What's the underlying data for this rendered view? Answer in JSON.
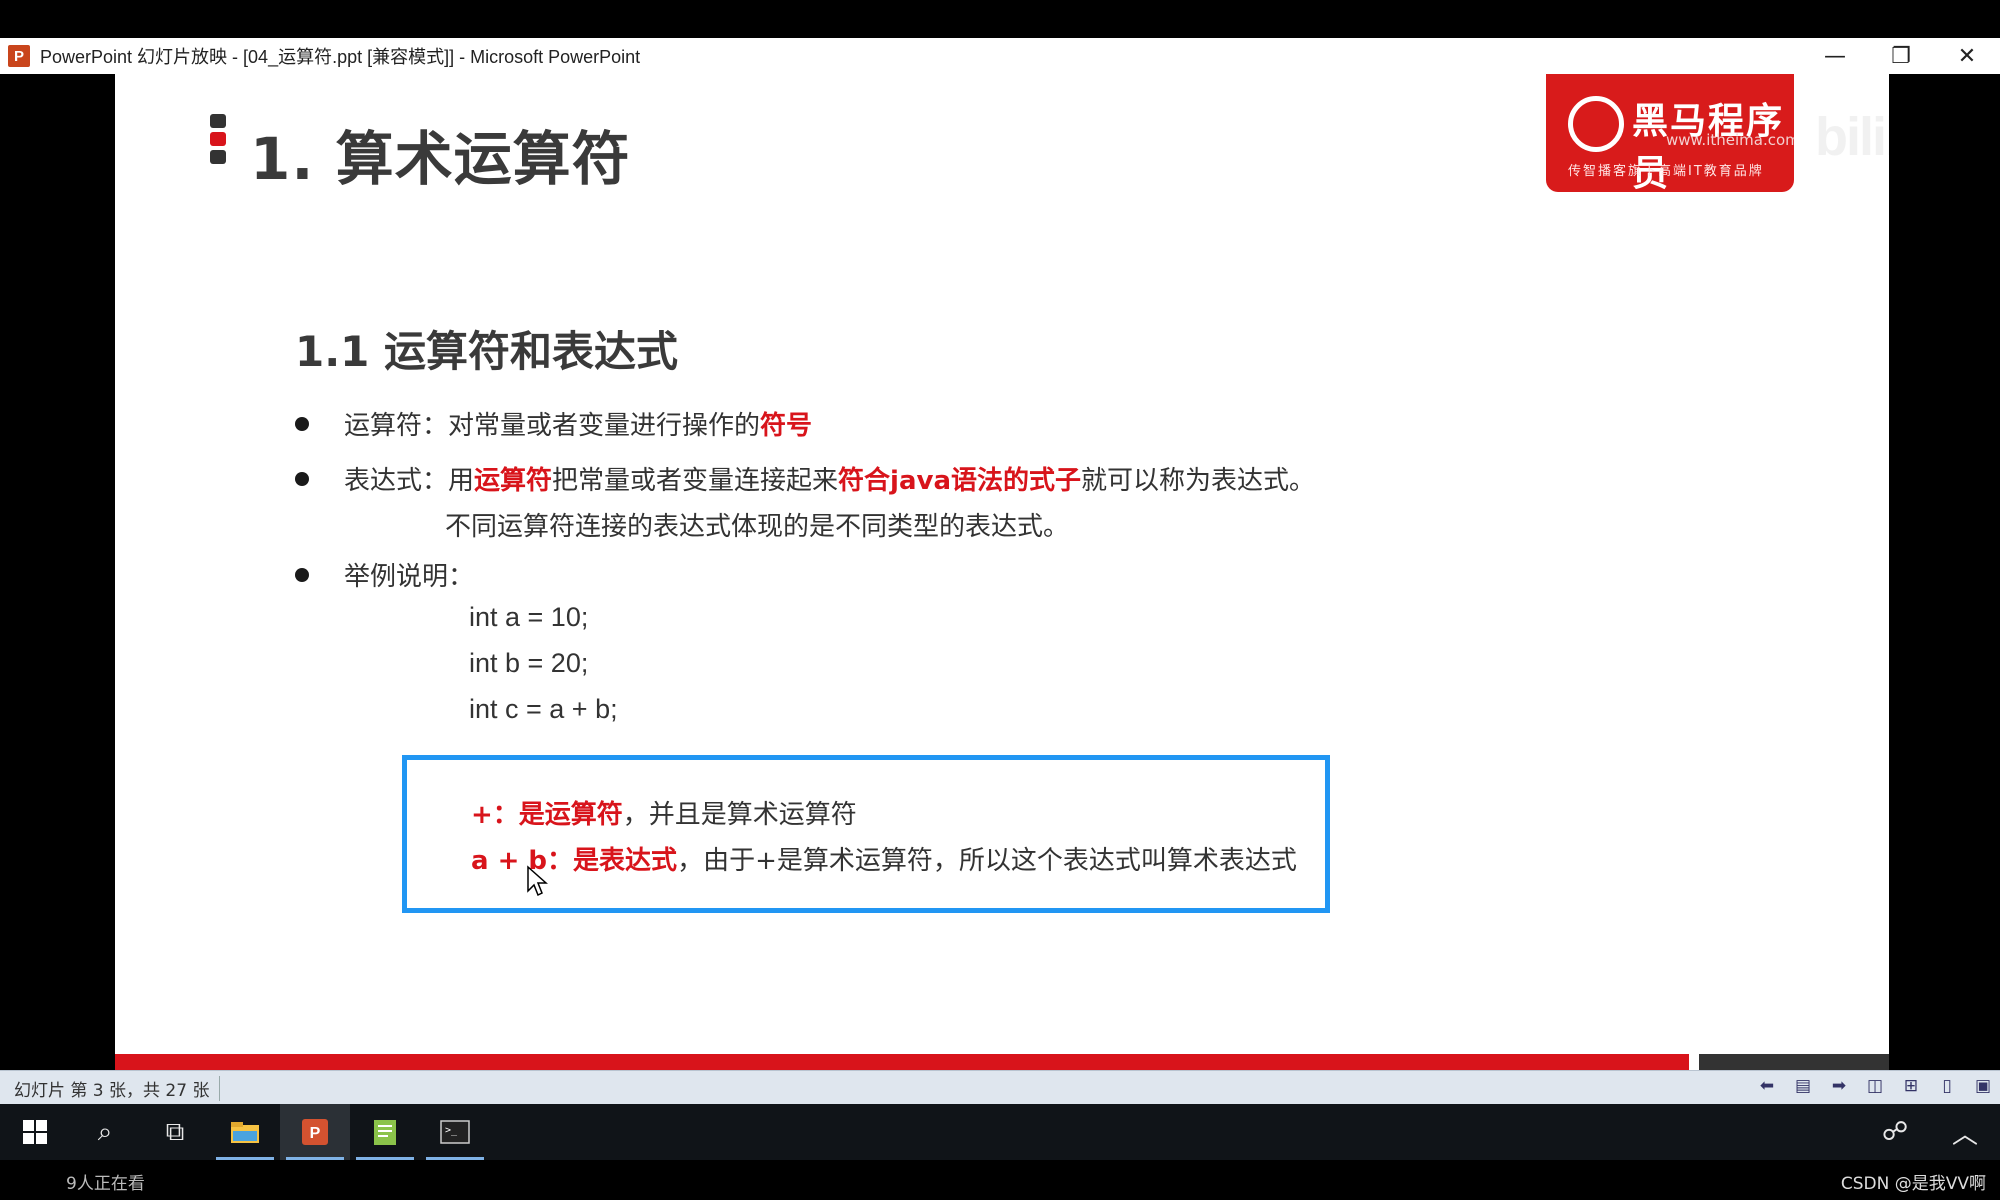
{
  "window": {
    "app_icon_letter": "P",
    "title": "PowerPoint 幻灯片放映 - [04_运算符.ppt [兼容模式]] - Microsoft PowerPoint",
    "minimize": "—",
    "restore": "❐",
    "close": "✕"
  },
  "slide": {
    "heading": "1. 算术运算符",
    "logo": {
      "name": "黑马程序员",
      "url": "www.itheima.com",
      "tagline": "传智播客旗下高端IT教育品牌"
    },
    "watermark": "bilibili",
    "subheading": "1.1 运算符和表达式",
    "bullet1": {
      "prefix": "运算符：对常量或者变量进行操作的",
      "highlight": "符号"
    },
    "bullet2": {
      "prefix": "表达式：用",
      "hl1": "运算符",
      "mid": "把常量或者变量连接起来",
      "hl2": "符合java语法的式子",
      "suffix": "就可以称为表达式。",
      "line2": "不同运算符连接的表达式体现的是不同类型的表达式。"
    },
    "bullet3": {
      "label": "举例说明：",
      "code": [
        "int a = 10;",
        "int b = 20;",
        "int c = a + b;"
      ]
    },
    "note": {
      "line1_hl": "+：是运算符",
      "line1_rest": "，并且是算术运算符",
      "line2_hl1": "a + b：",
      "line2_hl2": "是表达式",
      "line2_rest": "，由于+是算术运算符，所以这个表达式叫算术表达式"
    }
  },
  "statusbar": {
    "slide_info": "幻灯片 第 3 张，共 27 张"
  },
  "bottom": {
    "watchers": "9人正在看",
    "credit": "CSDN @是我VV啊"
  },
  "colors": {
    "accent_red": "#d8141b",
    "box_blue": "#2196f3"
  }
}
